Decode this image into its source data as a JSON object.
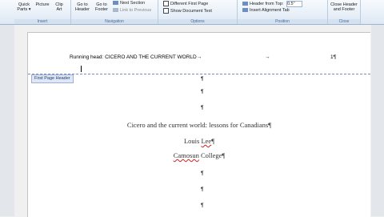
{
  "ribbon": {
    "groups": {
      "insert": "Insert",
      "navigation": "Navigation",
      "options": "Options",
      "position": "Position",
      "close": "Close"
    },
    "buttons": {
      "quick_parts_1": "Quick",
      "quick_parts_2": "Parts ▾",
      "picture": "Picture",
      "clip_art_1": "Clip",
      "clip_art_2": "Art",
      "goto_header_1": "Go to",
      "goto_header_2": "Header",
      "goto_footer_1": "Go to",
      "goto_footer_2": "Footer",
      "next_section": "Next Section",
      "link_to_previous": "Link to Previous",
      "different_first_page": "Different First Page",
      "show_document_text": "Show Document Text",
      "header_from_top": "Header from Top:",
      "insert_alignment_tab": "Insert Alignment Tab",
      "header_from_top_value": "0.5\"",
      "close_hf_1": "Close Header",
      "close_hf_2": "and Footer"
    }
  },
  "document": {
    "running_head": "Running head: CICERO AND THE CURRENT WORLD→",
    "tab_arrow": "→",
    "page_number": "1¶",
    "header_tag": "First Page Header",
    "pilcrow": "¶",
    "title": "Cicero and the current world: lessons for Canadians¶",
    "author_first": "Louis ",
    "author_last": "Lee",
    "author_end": "¶",
    "college_name": "Camosun",
    "college_rest": " College¶"
  }
}
